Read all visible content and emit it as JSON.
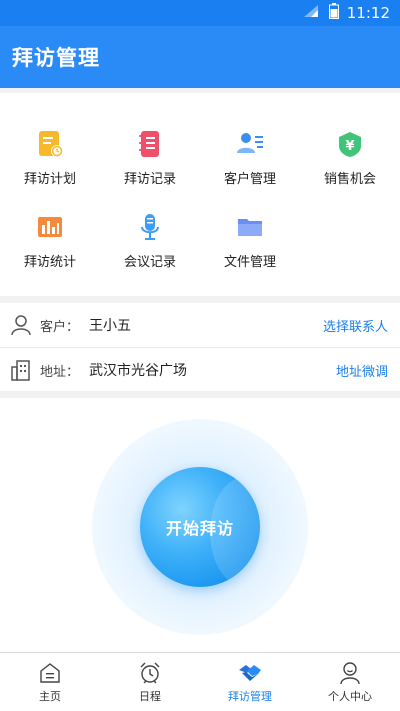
{
  "status_bar": {
    "time": "11:12"
  },
  "header": {
    "title": "拜访管理"
  },
  "menu": {
    "items": [
      {
        "label": "拜访计划",
        "icon": "visit-plan-icon"
      },
      {
        "label": "拜访记录",
        "icon": "visit-record-icon"
      },
      {
        "label": "客户管理",
        "icon": "customer-icon"
      },
      {
        "label": "销售机会",
        "icon": "sales-opportunity-icon"
      },
      {
        "label": "拜访统计",
        "icon": "statistics-icon"
      },
      {
        "label": "会议记录",
        "icon": "microphone-icon"
      },
      {
        "label": "文件管理",
        "icon": "folder-icon"
      }
    ]
  },
  "info": {
    "customer_label": "客户：",
    "customer_value": "王小五",
    "customer_action": "选择联系人",
    "address_label": "地址：",
    "address_value": "武汉市光谷广场",
    "address_action": "地址微调"
  },
  "start_button": {
    "label": "开始拜访"
  },
  "tabs": [
    {
      "label": "主页",
      "icon": "home-icon"
    },
    {
      "label": "日程",
      "icon": "alarm-clock-icon"
    },
    {
      "label": "拜访管理",
      "icon": "handshake-icon"
    },
    {
      "label": "个人中心",
      "icon": "person-icon"
    }
  ],
  "colors": {
    "primary": "#2b8bf6",
    "link": "#1a7ff0",
    "yellow": "#f7b92b",
    "pink": "#f04f6a",
    "green": "#3fc47a",
    "orange": "#f58a3e"
  }
}
